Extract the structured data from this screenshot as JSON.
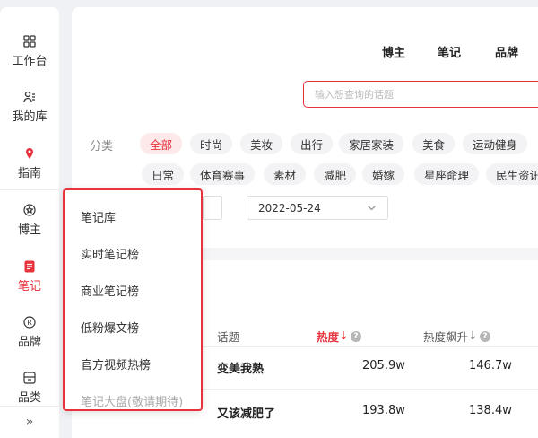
{
  "sidebar": {
    "items": [
      {
        "label": "工作台",
        "icon": "grid-icon"
      },
      {
        "label": "我的库",
        "icon": "user-list-icon"
      },
      {
        "label": "指南",
        "icon": "location-pin-icon"
      },
      {
        "label": "博主",
        "icon": "star-badge-icon"
      },
      {
        "label": "笔记",
        "icon": "note-icon"
      },
      {
        "label": "品牌",
        "icon": "registered-icon"
      },
      {
        "label": "品类",
        "icon": "category-box-icon"
      }
    ],
    "active": "笔记",
    "collapse_glyph": "»"
  },
  "topnav": {
    "items": [
      "博主",
      "笔记",
      "品牌"
    ]
  },
  "search": {
    "placeholder": "输入想查询的话题"
  },
  "filters": {
    "label": "分类",
    "row1": [
      "全部",
      "时尚",
      "美妆",
      "出行",
      "家居家装",
      "美食",
      "运动健身"
    ],
    "row2": [
      "日常",
      "体育赛事",
      "素材",
      "减肥",
      "婚嫁",
      "星座命理",
      "民生资讯"
    ],
    "selected": "全部"
  },
  "date": {
    "value": "2022-05-24"
  },
  "table": {
    "headers": {
      "topic": "话题",
      "heat": "热度",
      "heat_rise": "热度飙升"
    },
    "rows": [
      {
        "topic": "变美我熟",
        "heat": "205.9w",
        "rise": "146.7w"
      },
      {
        "topic": "又该减肥了",
        "heat": "193.8w",
        "rise": "138.4w"
      }
    ]
  },
  "dropdown": {
    "items": [
      "笔记库",
      "实时笔记榜",
      "商业笔记榜",
      "低粉爆文榜",
      "官方视频热榜"
    ],
    "disabled_item": "笔记大盘(敬请期待)"
  },
  "colors": {
    "accent": "#e8323c",
    "chip_bg": "#f3f3f5",
    "active_chip_bg": "#fde8ea"
  }
}
